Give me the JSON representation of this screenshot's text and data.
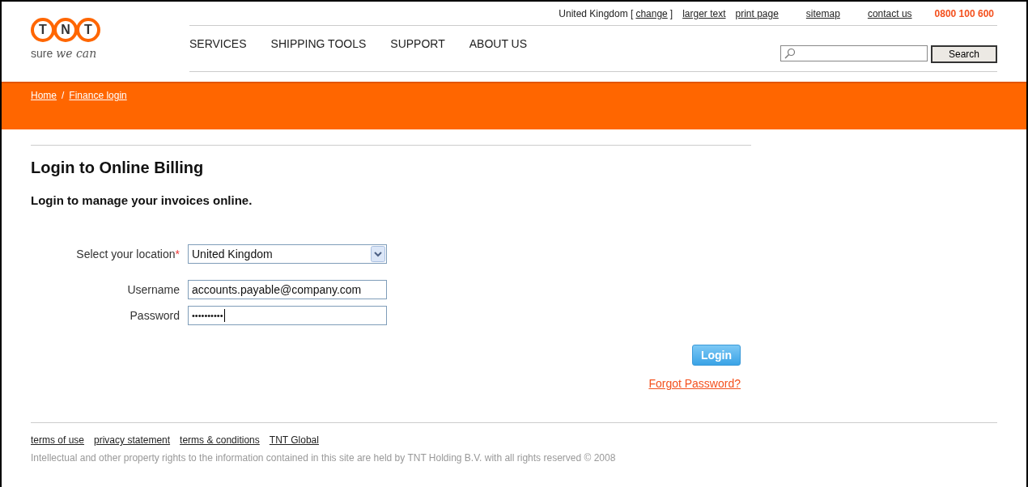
{
  "header": {
    "logo": {
      "letters": [
        "T",
        "N",
        "T"
      ],
      "tagline_plain": "sure",
      "tagline_script": "we can"
    },
    "utility": {
      "country": "United Kingdom",
      "change_open": "[",
      "change_link": "change",
      "change_close": "]",
      "links": [
        "larger text",
        "print page"
      ],
      "right_links": [
        "sitemap",
        "contact us"
      ],
      "phone": "0800 100 600"
    },
    "nav": [
      "SERVICES",
      "SHIPPING TOOLS",
      "SUPPORT",
      "ABOUT US"
    ],
    "search": {
      "button": "Search"
    }
  },
  "breadcrumb": {
    "items": [
      "Home",
      "Finance login"
    ],
    "separator": "/"
  },
  "main": {
    "title": "Login to Online Billing",
    "subtitle": "Login to manage your invoices online.",
    "fields": [
      {
        "kind": "select",
        "label": "Select your location",
        "required_mark": "*",
        "value": "United Kingdom"
      },
      {
        "kind": "text",
        "label": "Username",
        "value": "accounts.payable@company.com"
      },
      {
        "kind": "password",
        "label": "Password",
        "value": "••••••••••"
      }
    ],
    "login_button": "Login",
    "forgot_link": "Forgot Password?"
  },
  "footer": {
    "links": [
      "terms of use",
      "privacy statement",
      "terms & conditions",
      "TNT Global"
    ],
    "copyright": "Intellectual and other property rights to the information contained in this site are held by TNT Holding B.V. with all rights reserved © 2008"
  }
}
